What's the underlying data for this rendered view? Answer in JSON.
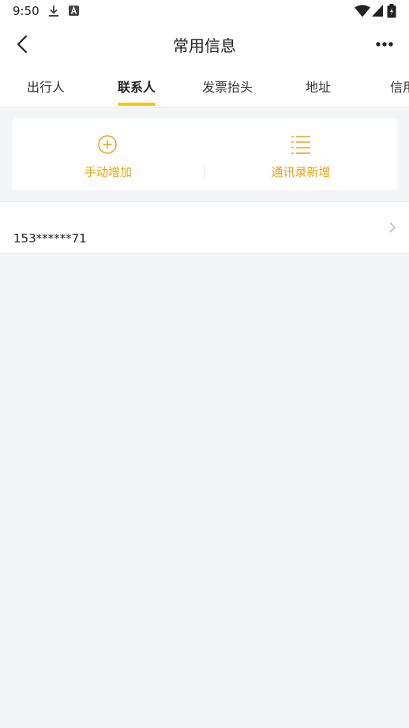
{
  "status": {
    "time": "9:50"
  },
  "header": {
    "title": "常用信息"
  },
  "tabs": [
    {
      "label": "出行人",
      "active": false
    },
    {
      "label": "联系人",
      "active": true
    },
    {
      "label": "发票抬头",
      "active": false
    },
    {
      "label": "地址",
      "active": false
    },
    {
      "label": "信用卡",
      "active": false
    }
  ],
  "actions": {
    "manual_add": {
      "label": "手动增加",
      "icon": "add-circle-icon"
    },
    "contacts_add": {
      "label": "通讯录新增",
      "icon": "list-icon"
    }
  },
  "contacts": [
    {
      "phone": "153******71"
    }
  ],
  "colors": {
    "accent": "#ffc300",
    "action_text": "#e8a310",
    "background": "#f4f5f7"
  }
}
